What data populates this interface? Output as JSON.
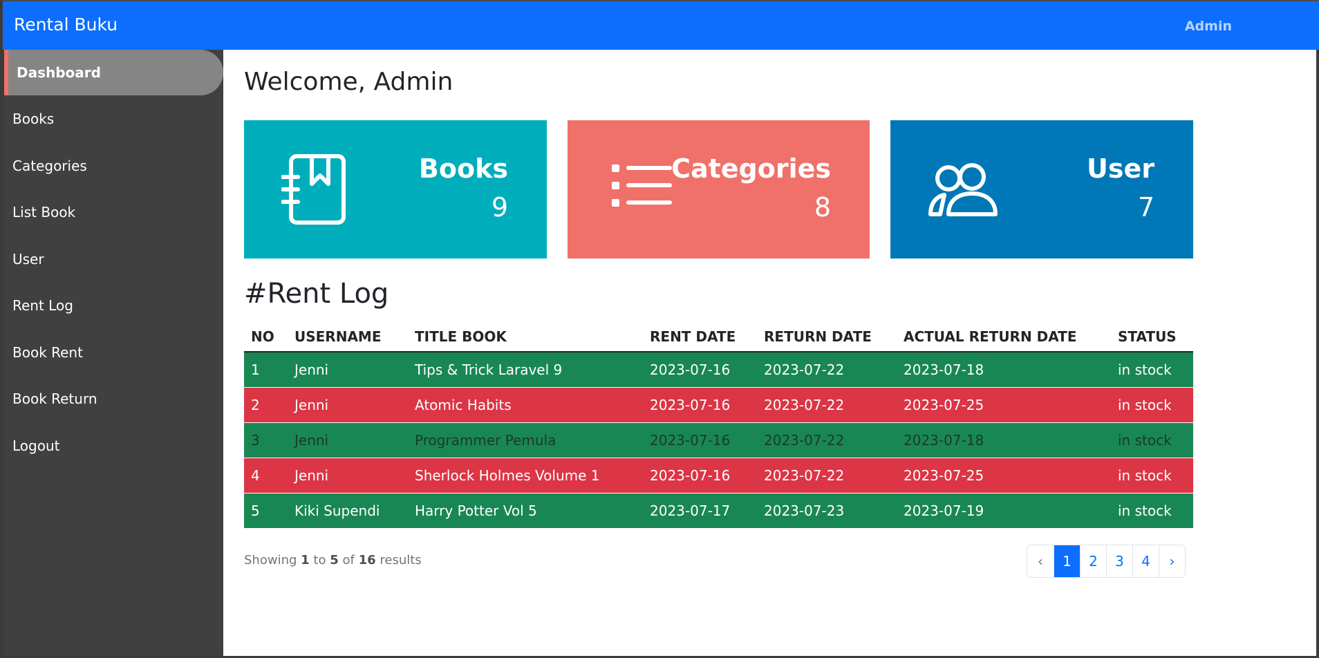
{
  "header": {
    "brand": "Rental Buku",
    "user_link": "Admin"
  },
  "sidebar": {
    "items": [
      {
        "label": "Dashboard",
        "active": true
      },
      {
        "label": "Books"
      },
      {
        "label": "Categories"
      },
      {
        "label": "List Book"
      },
      {
        "label": "User"
      },
      {
        "label": "Rent Log"
      },
      {
        "label": "Book Rent"
      },
      {
        "label": "Book Return"
      },
      {
        "label": "Logout"
      }
    ]
  },
  "main": {
    "welcome": "Welcome, Admin",
    "cards": [
      {
        "title": "Books",
        "count": "9",
        "icon": "book-icon",
        "color": "#00aebb"
      },
      {
        "title": "Categories",
        "count": "8",
        "icon": "list-icon",
        "color": "#f0716a"
      },
      {
        "title": "User",
        "count": "7",
        "icon": "users-icon",
        "color": "#0077b6"
      }
    ],
    "rent_log_title": "#Rent Log",
    "table": {
      "headers": [
        "NO",
        "USERNAME",
        "TITLE BOOK",
        "RENT DATE",
        "RETURN DATE",
        "ACTUAL RETURN DATE",
        "STATUS"
      ],
      "rows": [
        [
          "1",
          "Jenni",
          "Tips & Trick Laravel 9",
          "2023-07-16",
          "2023-07-22",
          "2023-07-18",
          "in stock"
        ],
        [
          "2",
          "Jenni",
          "Atomic Habits",
          "2023-07-16",
          "2023-07-22",
          "2023-07-25",
          "in stock"
        ],
        [
          "3",
          "Jenni",
          "Programmer Pemula",
          "2023-07-16",
          "2023-07-22",
          "2023-07-18",
          "in stock"
        ],
        [
          "4",
          "Jenni",
          "Sherlock Holmes Volume 1",
          "2023-07-16",
          "2023-07-22",
          "2023-07-25",
          "in stock"
        ],
        [
          "5",
          "Kiki Supendi",
          "Harry Potter Vol 5",
          "2023-07-17",
          "2023-07-23",
          "2023-07-19",
          "in stock"
        ]
      ]
    },
    "showing": {
      "prefix": "Showing",
      "from": "1",
      "to_word": "to",
      "to": "5",
      "of_word": "of",
      "total": "16",
      "suffix": "results"
    },
    "pagination": [
      "‹",
      "1",
      "2",
      "3",
      "4",
      "›"
    ]
  },
  "colors": {
    "topbar": "#0d6efd",
    "sidebar": "#404040",
    "row_green": "#198754",
    "row_red": "#dc3545"
  }
}
